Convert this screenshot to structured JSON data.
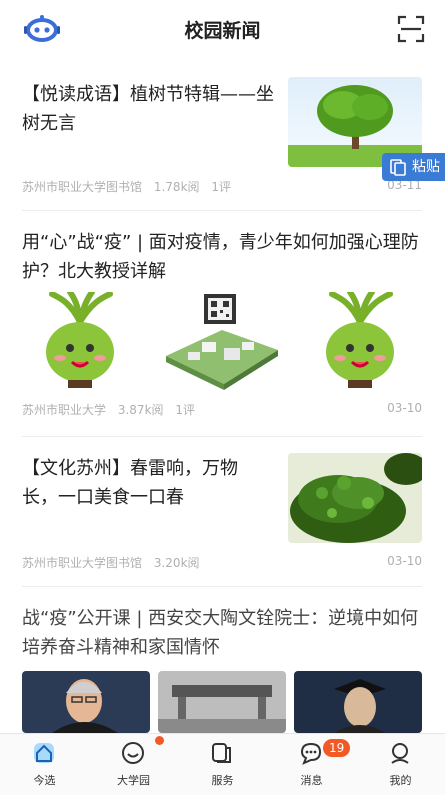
{
  "header": {
    "title": "校园新闻"
  },
  "articles": [
    {
      "headline": "【悦读成语】植树节特辑——坐树无言",
      "source": "苏州市职业大学图书馆",
      "reads": "1.78k阅",
      "comments": "1评",
      "date": "03-11"
    },
    {
      "headline": "用“心”战“疫” | 面对疫情，青少年如何加强心理防护？北大教授详解",
      "source": "苏州市职业大学",
      "reads": "3.87k阅",
      "comments": "1评",
      "date": "03-10"
    },
    {
      "headline": "【文化苏州】春雷响，万物长，一口美食一口春",
      "source": "苏州市职业大学图书馆",
      "reads": "3.20k阅",
      "comments": "",
      "date": "03-10"
    },
    {
      "headline": "战“疫”公开课 | 西安交大陶文铨院士：逆境中如何培养奋斗精神和家国情怀"
    }
  ],
  "paste_tag": {
    "label": "粘贴"
  },
  "tabbar": {
    "items": [
      {
        "label": "今选",
        "icon": "home-icon"
      },
      {
        "label": "大学园",
        "icon": "smile-icon"
      },
      {
        "label": "服务",
        "icon": "service-icon"
      },
      {
        "label": "消息",
        "icon": "chat-icon"
      },
      {
        "label": "我的",
        "icon": "user-icon"
      }
    ],
    "messages_badge": "19"
  },
  "colors": {
    "accent": "#3a7bd5",
    "badge": "#f15a24",
    "meta_text": "#b0b0b0"
  }
}
